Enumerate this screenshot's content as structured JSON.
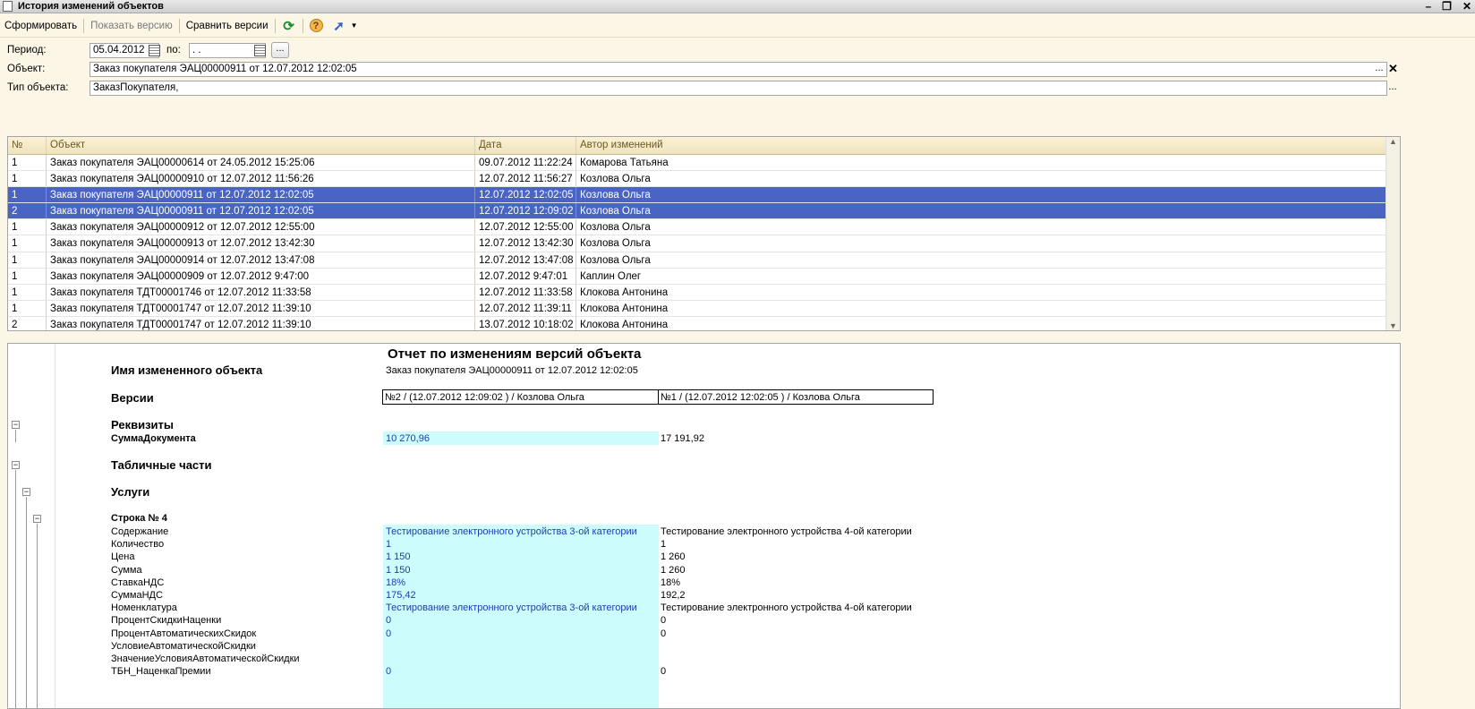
{
  "window": {
    "title": "История изменений объектов"
  },
  "toolbar": {
    "generate": "Сформировать",
    "show_version": "Показать версию",
    "compare": "Сравнить версии",
    "help_glyph": "?"
  },
  "filters": {
    "period_label": "Период:",
    "period_from": "05.04.2012",
    "to_label": "по:",
    "period_to": " .  .",
    "object_label": "Объект:",
    "object_value": "Заказ покупателя ЭАЦ00000911 от 12.07.2012 12:02:05",
    "type_label": "Тип объекта:",
    "type_value": "ЗаказПокупателя,",
    "ellipsis": "..."
  },
  "table": {
    "headers": [
      "№",
      "Объект",
      "Дата",
      "Автор изменений"
    ],
    "rows": [
      {
        "n": "1",
        "object": "Заказ покупателя ЭАЦ00000614 от 24.05.2012 15:25:06",
        "date": "09.07.2012 11:22:24",
        "author": "Комарова Татьяна",
        "selected": false
      },
      {
        "n": "1",
        "object": "Заказ покупателя ЭАЦ00000910 от 12.07.2012 11:56:26",
        "date": "12.07.2012 11:56:27",
        "author": "Козлова Ольга",
        "selected": false
      },
      {
        "n": "1",
        "object": "Заказ покупателя ЭАЦ00000911 от 12.07.2012 12:02:05",
        "date": "12.07.2012 12:02:05",
        "author": "Козлова Ольга",
        "selected": true
      },
      {
        "n": "2",
        "object": "Заказ покупателя ЭАЦ00000911 от 12.07.2012 12:02:05",
        "date": "12.07.2012 12:09:02",
        "author": "Козлова Ольга",
        "selected": true
      },
      {
        "n": "1",
        "object": "Заказ покупателя ЭАЦ00000912 от 12.07.2012 12:55:00",
        "date": "12.07.2012 12:55:00",
        "author": "Козлова Ольга",
        "selected": false
      },
      {
        "n": "1",
        "object": "Заказ покупателя ЭАЦ00000913 от 12.07.2012 13:42:30",
        "date": "12.07.2012 13:42:30",
        "author": "Козлова Ольга",
        "selected": false
      },
      {
        "n": "1",
        "object": "Заказ покупателя ЭАЦ00000914 от 12.07.2012 13:47:08",
        "date": "12.07.2012 13:47:08",
        "author": "Козлова Ольга",
        "selected": false
      },
      {
        "n": "1",
        "object": "Заказ покупателя ЭАЦ00000909 от 12.07.2012 9:47:00",
        "date": "12.07.2012 9:47:01",
        "author": "Каплин Олег",
        "selected": false
      },
      {
        "n": "1",
        "object": "Заказ покупателя ТДТ00001746 от 12.07.2012 11:33:58",
        "date": "12.07.2012 11:33:58",
        "author": "Клокова Антонина",
        "selected": false
      },
      {
        "n": "1",
        "object": "Заказ покупателя ТДТ00001747 от 12.07.2012 11:39:10",
        "date": "12.07.2012 11:39:11",
        "author": "Клокова Антонина",
        "selected": false
      },
      {
        "n": "2",
        "object": "Заказ покупателя ТДТ00001747 от 12.07.2012 11:39:10",
        "date": "13.07.2012 10:18:02",
        "author": "Клокова Антонина",
        "selected": false
      }
    ]
  },
  "report": {
    "title": "Отчет по изменениям версий объекта",
    "object_name_label": "Имя измененного объекта",
    "object_name_value": "Заказ покупателя ЭАЦ00000911 от 12.07.2012 12:02:05",
    "versions_label": "Версии",
    "version_a": "№2 / (12.07.2012 12:09:02 ) / Козлова Ольга",
    "version_b": "№1 / (12.07.2012 12:02:05 ) / Козлова Ольга",
    "requisites_label": "Реквизиты",
    "doc_sum_label": "СуммаДокумента",
    "doc_sum_a": "10 270,96",
    "doc_sum_b": "17 191,92",
    "tabular_label": "Табличные части",
    "services_label": "Услуги",
    "row_label": "Строка № 4",
    "fields": [
      {
        "name": "Содержание",
        "a": "Тестирование электронного устройства 3-ой категории",
        "b": "Тестирование электронного устройства 4-ой категории"
      },
      {
        "name": "Количество",
        "a": "1",
        "b": "1"
      },
      {
        "name": "Цена",
        "a": "1 150",
        "b": "1 260"
      },
      {
        "name": "Сумма",
        "a": "1 150",
        "b": "1 260"
      },
      {
        "name": "СтавкаНДС",
        "a": "18%",
        "b": "18%"
      },
      {
        "name": "СуммаНДС",
        "a": "175,42",
        "b": "192,2"
      },
      {
        "name": "Номенклатура",
        "a": "Тестирование электронного устройства 3-ой категории",
        "b": "Тестирование электронного устройства 4-ой категории"
      },
      {
        "name": "ПроцентСкидкиНаценки",
        "a": "0",
        "b": "0"
      },
      {
        "name": "ПроцентАвтоматическихСкидок",
        "a": "0",
        "b": "0"
      },
      {
        "name": "УсловиеАвтоматическойСкидки",
        "a": "",
        "b": ""
      },
      {
        "name": "ЗначениеУсловияАвтоматическойСкидки",
        "a": "",
        "b": ""
      },
      {
        "name": "ТБН_НаценкаПремии",
        "a": "0",
        "b": "0"
      }
    ]
  }
}
